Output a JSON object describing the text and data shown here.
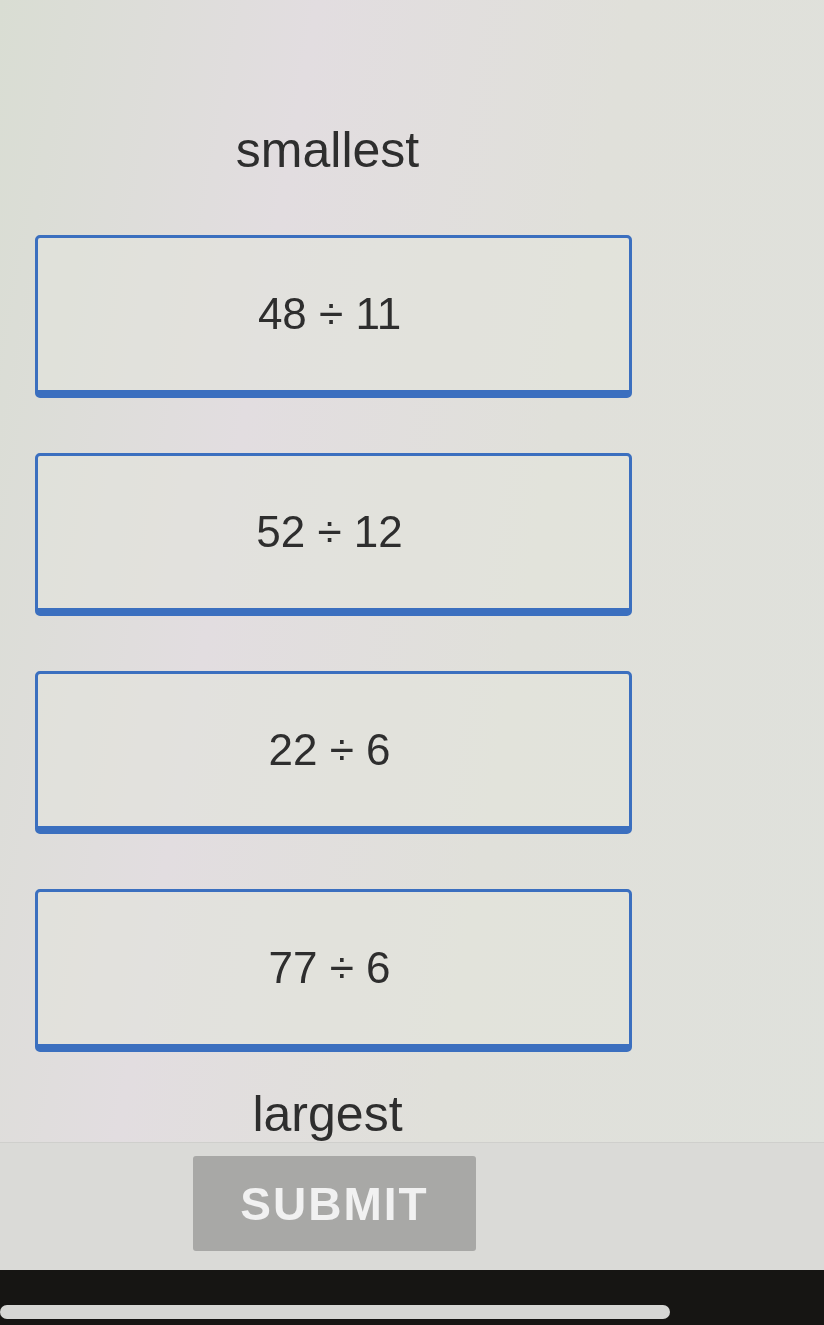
{
  "labels": {
    "top": "smallest",
    "bottom": "largest"
  },
  "cards": [
    {
      "expression": "48 ÷ 11"
    },
    {
      "expression": "52 ÷ 12"
    },
    {
      "expression": "22 ÷ 6"
    },
    {
      "expression": "77 ÷ 6"
    }
  ],
  "submit": {
    "label": "SUBMIT",
    "disabled": true
  }
}
